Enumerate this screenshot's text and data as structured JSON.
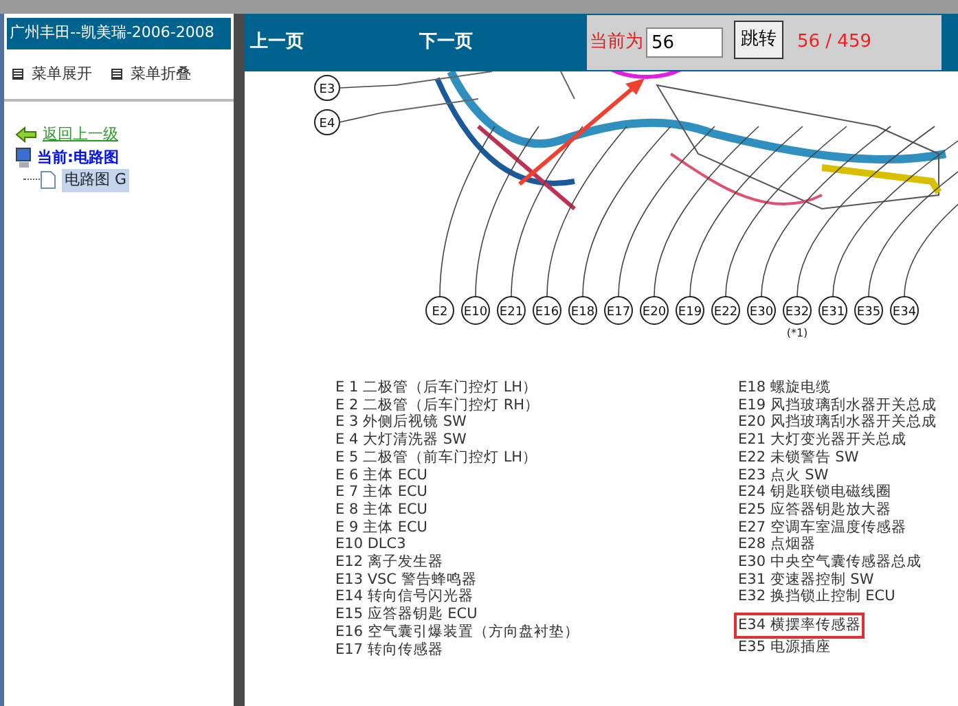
{
  "sidebar": {
    "title": "广州丰田--凯美瑞-2006-2008",
    "menu": [
      {
        "label": "菜单展开"
      },
      {
        "label": "菜单折叠"
      }
    ],
    "back_link": "返回上一级",
    "current": "当前:电路图",
    "tree": [
      {
        "label": "电路图 G",
        "selected": true
      }
    ]
  },
  "toolbar": {
    "prev": "上一页",
    "next": "下一页",
    "page_label": "当前为",
    "page_value": "56",
    "go_button": "跳转",
    "page_count": "56 / 459"
  },
  "diagram": {
    "top_connectors": [
      "E3",
      "E4"
    ],
    "connectors": [
      {
        "label": "E2"
      },
      {
        "label": "E10"
      },
      {
        "label": "E21"
      },
      {
        "label": "E16"
      },
      {
        "label": "E18"
      },
      {
        "label": "E17"
      },
      {
        "label": "E20"
      },
      {
        "label": "E19"
      },
      {
        "label": "E22"
      },
      {
        "label": "E30"
      },
      {
        "label": "E32",
        "note": "(*1)"
      },
      {
        "label": "E31"
      },
      {
        "label": "E35"
      },
      {
        "label": "E34"
      }
    ]
  },
  "legend_left": [
    {
      "text": "E 1 二极管（后车门控灯 LH）",
      "highlighted": false
    },
    {
      "text": "E 2 二极管（后车门控灯 RH）",
      "highlighted": false
    },
    {
      "text": "E 3 外侧后视镜 SW",
      "highlighted": false
    },
    {
      "text": "E 4 大灯清洗器 SW",
      "highlighted": false
    },
    {
      "text": "E 5 二极管（前车门控灯 LH）",
      "highlighted": false
    },
    {
      "text": "E 6 主体 ECU",
      "highlighted": false
    },
    {
      "text": "E 7 主体 ECU",
      "highlighted": false
    },
    {
      "text": "E 8 主体 ECU",
      "highlighted": false
    },
    {
      "text": "E 9 主体 ECU",
      "highlighted": false
    },
    {
      "text": "E10 DLC3",
      "highlighted": false
    },
    {
      "text": "E12 离子发生器",
      "highlighted": false
    },
    {
      "text": "E13 VSC 警告蜂鸣器",
      "highlighted": false
    },
    {
      "text": "E14 转向信号闪光器",
      "highlighted": false
    },
    {
      "text": "E15 应答器钥匙 ECU",
      "highlighted": false
    },
    {
      "text": "E16 空气囊引爆装置（方向盘衬垫）",
      "highlighted": false
    },
    {
      "text": "E17 转向传感器",
      "highlighted": false
    }
  ],
  "legend_right": [
    {
      "text": "E18 螺旋电缆",
      "highlighted": false
    },
    {
      "text": "E19 风挡玻璃刮水器开关总成",
      "highlighted": false
    },
    {
      "text": "E20 风挡玻璃刮水器开关总成",
      "highlighted": false
    },
    {
      "text": "E21 大灯变光器开关总成",
      "highlighted": false
    },
    {
      "text": "E22 未锁警告 SW",
      "highlighted": false
    },
    {
      "text": "E23 点火 SW",
      "highlighted": false
    },
    {
      "text": "E24 钥匙联锁电磁线圈",
      "highlighted": false
    },
    {
      "text": "E25 应答器钥匙放大器",
      "highlighted": false
    },
    {
      "text": "E27 空调车室温度传感器",
      "highlighted": false
    },
    {
      "text": "E28 点烟器",
      "highlighted": false
    },
    {
      "text": "E30 中央空气囊传感器总成",
      "highlighted": false
    },
    {
      "text": "E31 变速器控制 SW",
      "highlighted": false
    },
    {
      "text": "E32 换挡锁止控制 ECU",
      "highlighted": false
    },
    {
      "text": "E34 横摆率传感器",
      "highlighted": true
    },
    {
      "text": "E35 电源插座",
      "highlighted": false
    }
  ]
}
